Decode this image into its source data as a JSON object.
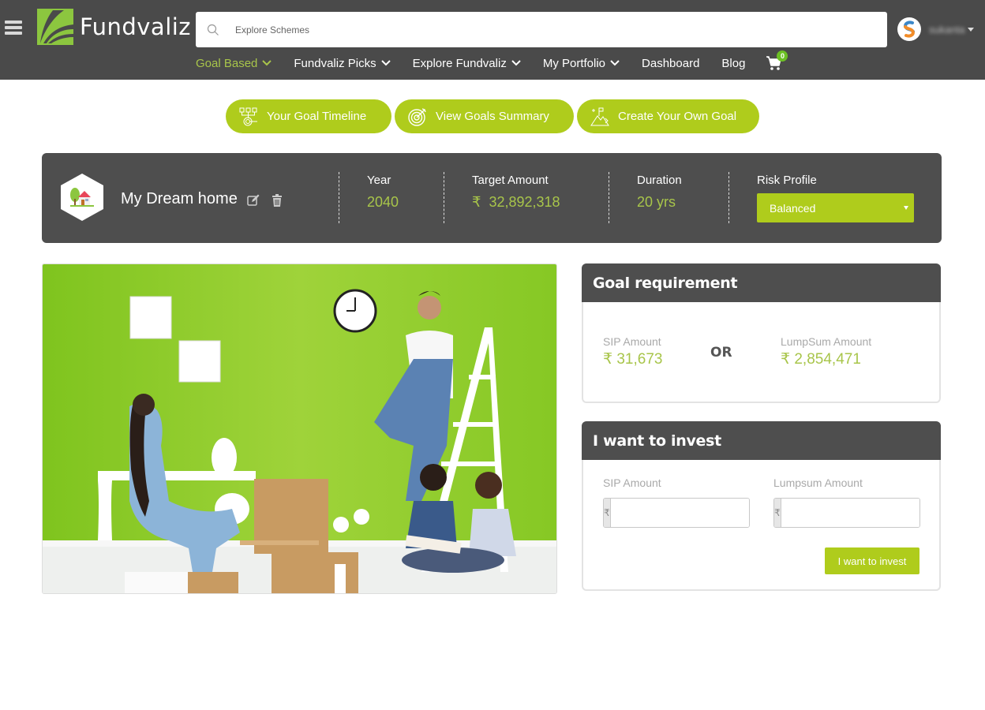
{
  "header": {
    "brand": "Fundvaliz",
    "search_placeholder": "Explore Schemes",
    "user_name": "sukanta",
    "nav": [
      {
        "label": "Goal Based",
        "has_dropdown": true,
        "active": true
      },
      {
        "label": "Fundvaliz Picks",
        "has_dropdown": true
      },
      {
        "label": "Explore Fundvaliz",
        "has_dropdown": true
      },
      {
        "label": "My Portfolio",
        "has_dropdown": true
      },
      {
        "label": "Dashboard",
        "has_dropdown": false
      },
      {
        "label": "Blog",
        "has_dropdown": false
      }
    ],
    "cart_count": "0"
  },
  "actions": [
    {
      "label": "Your Goal Timeline",
      "icon": "timeline-icon"
    },
    {
      "label": "View Goals Summary",
      "icon": "target-icon"
    },
    {
      "label": "Create Your Own Goal",
      "icon": "mountain-goal-icon"
    }
  ],
  "goal": {
    "name": "My Dream home",
    "icon": "home-icon",
    "year_label": "Year",
    "year": "2040",
    "target_label": "Target Amount",
    "currency": "₹",
    "target": "32,892,318",
    "duration_label": "Duration",
    "duration": "20 yrs",
    "risk_label": "Risk Profile",
    "risk_value": "Balanced"
  },
  "hero_image": "family decorating new home with green wall",
  "requirement": {
    "title": "Goal requirement",
    "sip_label": "SIP Amount",
    "sip_value": "₹ 31,673",
    "or": "OR",
    "lump_label": "LumpSum Amount",
    "lump_value": "₹ 2,854,471"
  },
  "invest": {
    "title": "I want to invest",
    "sip_label": "SIP Amount",
    "lump_label": "Lumpsum Amount",
    "currency": "₹",
    "sip_value": "",
    "lump_value": "",
    "button": "I want to invest"
  },
  "colors": {
    "accent": "#afcc1c",
    "header_bg": "#4a4a4a",
    "panel_bg": "#4e4e4e",
    "value_green": "#a8c54a"
  }
}
